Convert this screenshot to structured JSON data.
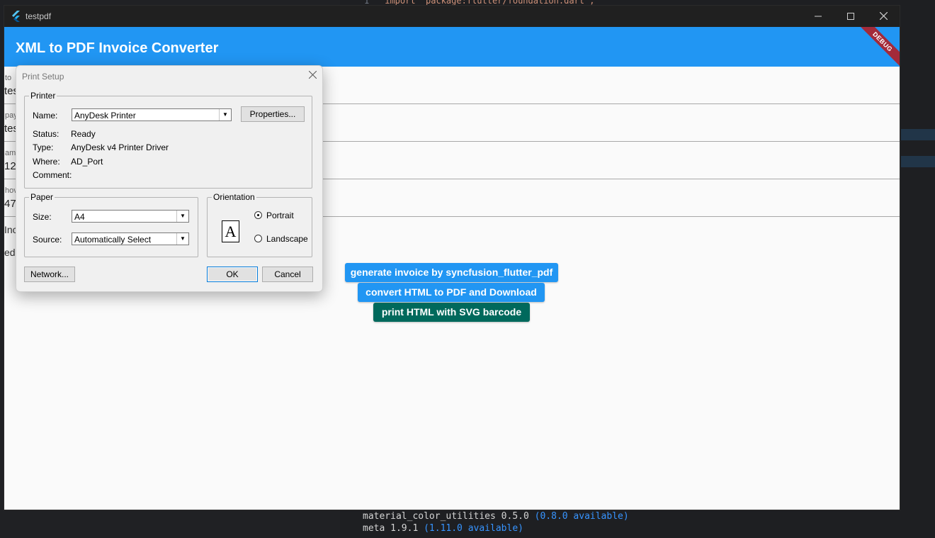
{
  "editor": {
    "line_number": "1",
    "code_line": "import 'package:flutter/foundation.dart';",
    "terminal": [
      {
        "text": "material_color_utilities 0.5.0 ",
        "available": "(0.8.0 available)"
      },
      {
        "text": "meta 1.9.1 ",
        "available": "(1.11.0 available)"
      }
    ]
  },
  "window": {
    "title": "testpdf",
    "minimize_icon": "minimize-icon",
    "maximize_icon": "maximize-icon",
    "close_icon": "close-icon"
  },
  "appbar": {
    "title": "XML to PDF Invoice Converter",
    "debug_label": "DEBUG",
    "color": "#2196f3"
  },
  "fields": [
    {
      "label": "to",
      "value": "tes"
    },
    {
      "label": "pay",
      "value": "tes"
    },
    {
      "label": "am",
      "value": "12"
    },
    {
      "label": "hov",
      "value": "47"
    }
  ],
  "text_lines": [
    "Inc",
    "ed"
  ],
  "buttons": {
    "generate": "generate invoice by syncfusion_flutter_pdf",
    "convert": "convert HTML to PDF and Download",
    "print": "print HTML with SVG barcode"
  },
  "dialog": {
    "title": "Print Setup",
    "printer_group": "Printer",
    "name_label": "Name:",
    "name_value": "AnyDesk Printer",
    "properties_button": "Properties...",
    "status_label": "Status:",
    "status_value": "Ready",
    "type_label": "Type:",
    "type_value": "AnyDesk v4 Printer Driver",
    "where_label": "Where:",
    "where_value": "AD_Port",
    "comment_label": "Comment:",
    "comment_value": "",
    "paper_group": "Paper",
    "size_label": "Size:",
    "size_value": "A4",
    "source_label": "Source:",
    "source_value": "Automatically Select",
    "orientation_group": "Orientation",
    "orientation_preview": "A",
    "portrait_label": "Portrait",
    "landscape_label": "Landscape",
    "orientation_selected": "Portrait",
    "network_button": "Network...",
    "ok_button": "OK",
    "cancel_button": "Cancel"
  }
}
